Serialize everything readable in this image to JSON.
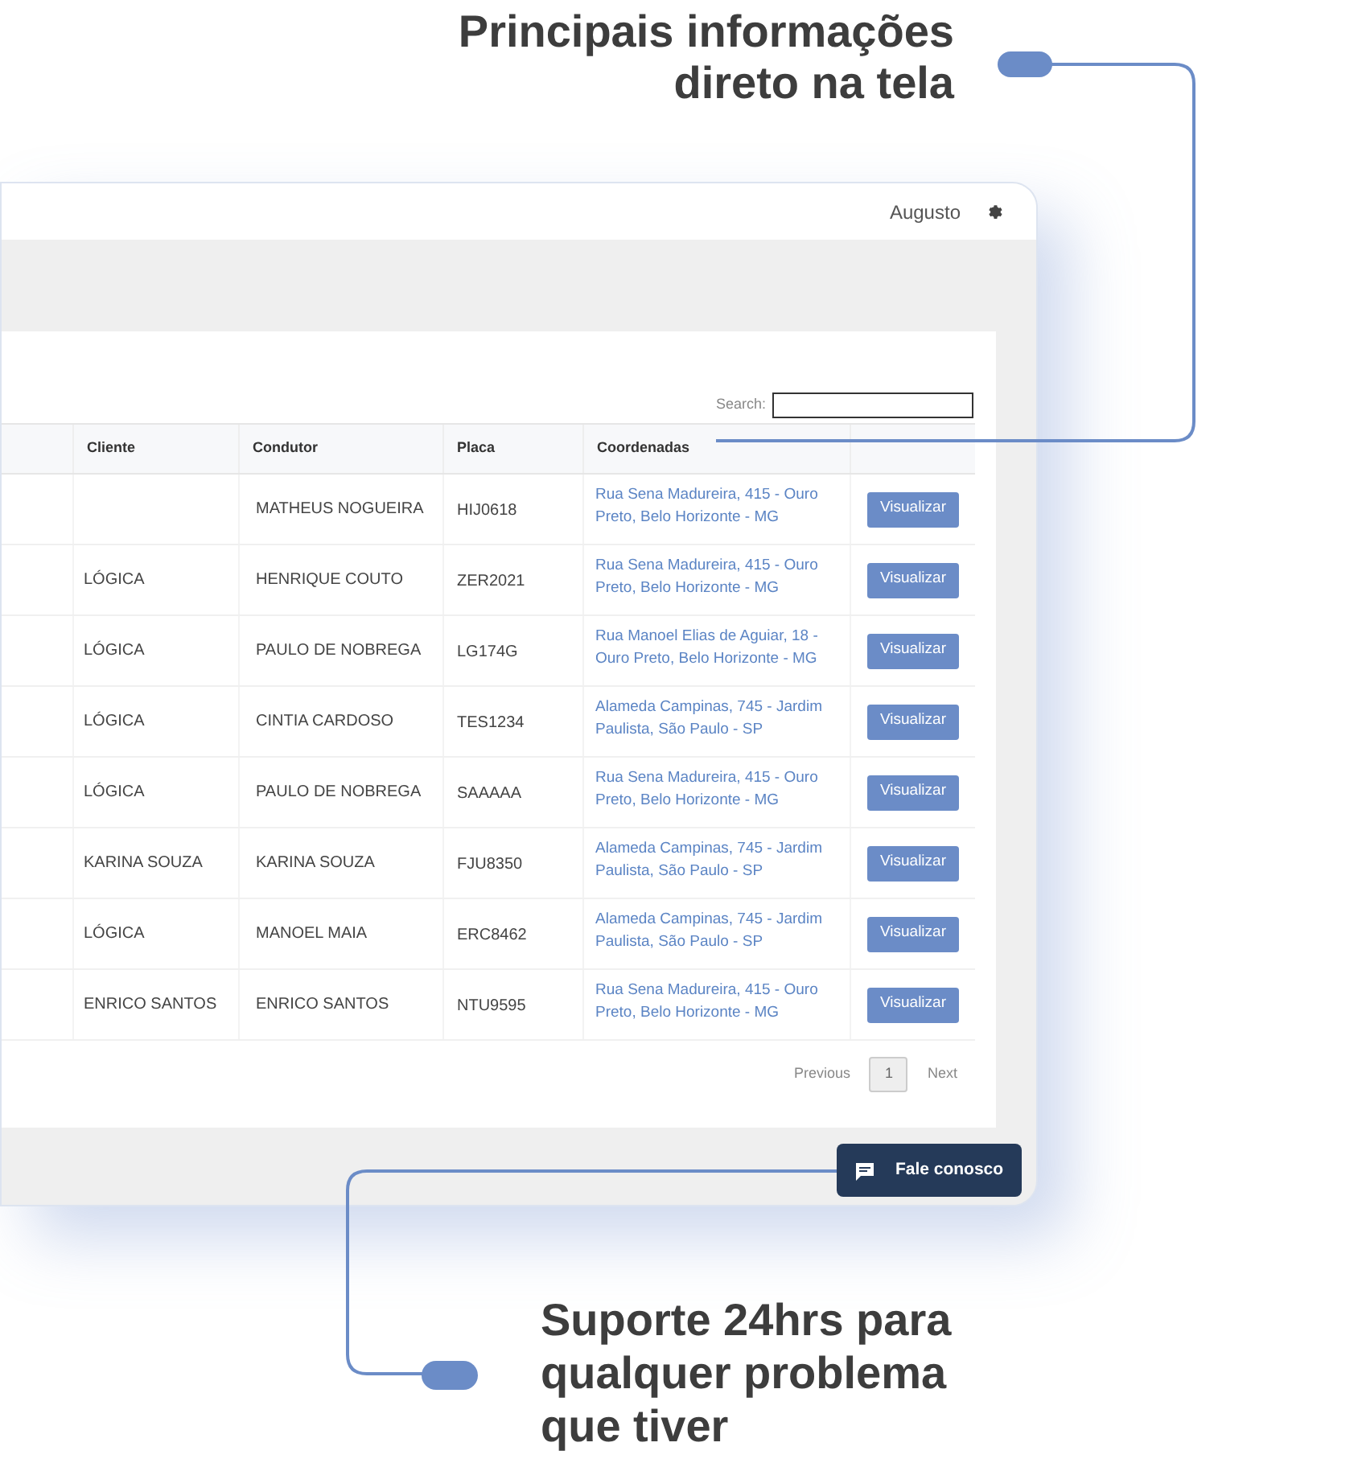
{
  "headline_top": [
    "Principais informações",
    "direto na tela"
  ],
  "header": {
    "user": "Augusto"
  },
  "search": {
    "label": "Search:"
  },
  "table": {
    "columns": [
      "Cliente",
      "Condutor",
      "Placa",
      "Coordenadas"
    ],
    "rows": [
      {
        "condutor": "MATHEUS NOGUEIRA",
        "placa": "HIJ0618",
        "coordenadas": "Rua Sena Madureira, 415 - Ouro Preto, Belo Horizonte - MG",
        "action": "Visualizar"
      },
      {
        "cliente": "LÓGICA",
        "condutor": "HENRIQUE COUTO",
        "placa": "ZER2021",
        "coordenadas": "Rua Sena Madureira, 415 - Ouro Preto, Belo Horizonte - MG",
        "action": "Visualizar"
      },
      {
        "cliente": "LÓGICA",
        "condutor": "PAULO DE NOBREGA",
        "placa": "LG174G",
        "coordenadas": "Rua Manoel Elias de Aguiar, 18 - Ouro Preto, Belo Horizonte - MG",
        "action": "Visualizar"
      },
      {
        "cliente": "LÓGICA",
        "condutor": "CINTIA CARDOSO",
        "placa": "TES1234",
        "coordenadas": "Alameda Campinas, 745 - Jardim Paulista, São Paulo - SP",
        "action": "Visualizar"
      },
      {
        "cliente": "LÓGICA",
        "condutor": "PAULO DE NOBREGA",
        "placa": "SAAAAA",
        "coordenadas": "Rua Sena Madureira, 415 - Ouro Preto, Belo Horizonte - MG",
        "action": "Visualizar"
      },
      {
        "cliente": "KARINA SOUZA",
        "condutor": "KARINA SOUZA",
        "placa": "FJU8350",
        "coordenadas": "Alameda Campinas, 745 - Jardim Paulista, São Paulo - SP",
        "action": "Visualizar"
      },
      {
        "cliente": "LÓGICA",
        "condutor": "MANOEL MAIA",
        "placa": "ERC8462",
        "coordenadas": "Alameda Campinas, 745 - Jardim Paulista, São Paulo - SP",
        "action": "Visualizar"
      },
      {
        "cliente": "ENRICO SANTOS",
        "condutor": "ENRICO SANTOS",
        "placa": "NTU9595",
        "coordenadas": "Rua Sena Madureira, 415 - Ouro Preto, Belo Horizonte - MG",
        "action": "Visualizar"
      }
    ]
  },
  "pagination": {
    "previous": "Previous",
    "pages": [
      {
        "label": "1",
        "selected": true
      }
    ],
    "next": "Next"
  },
  "chat_button": {
    "label": "Fale conosco"
  },
  "headline_bottom": [
    "Suporte 24hrs para",
    "qualquer problema",
    "que tiver"
  ]
}
